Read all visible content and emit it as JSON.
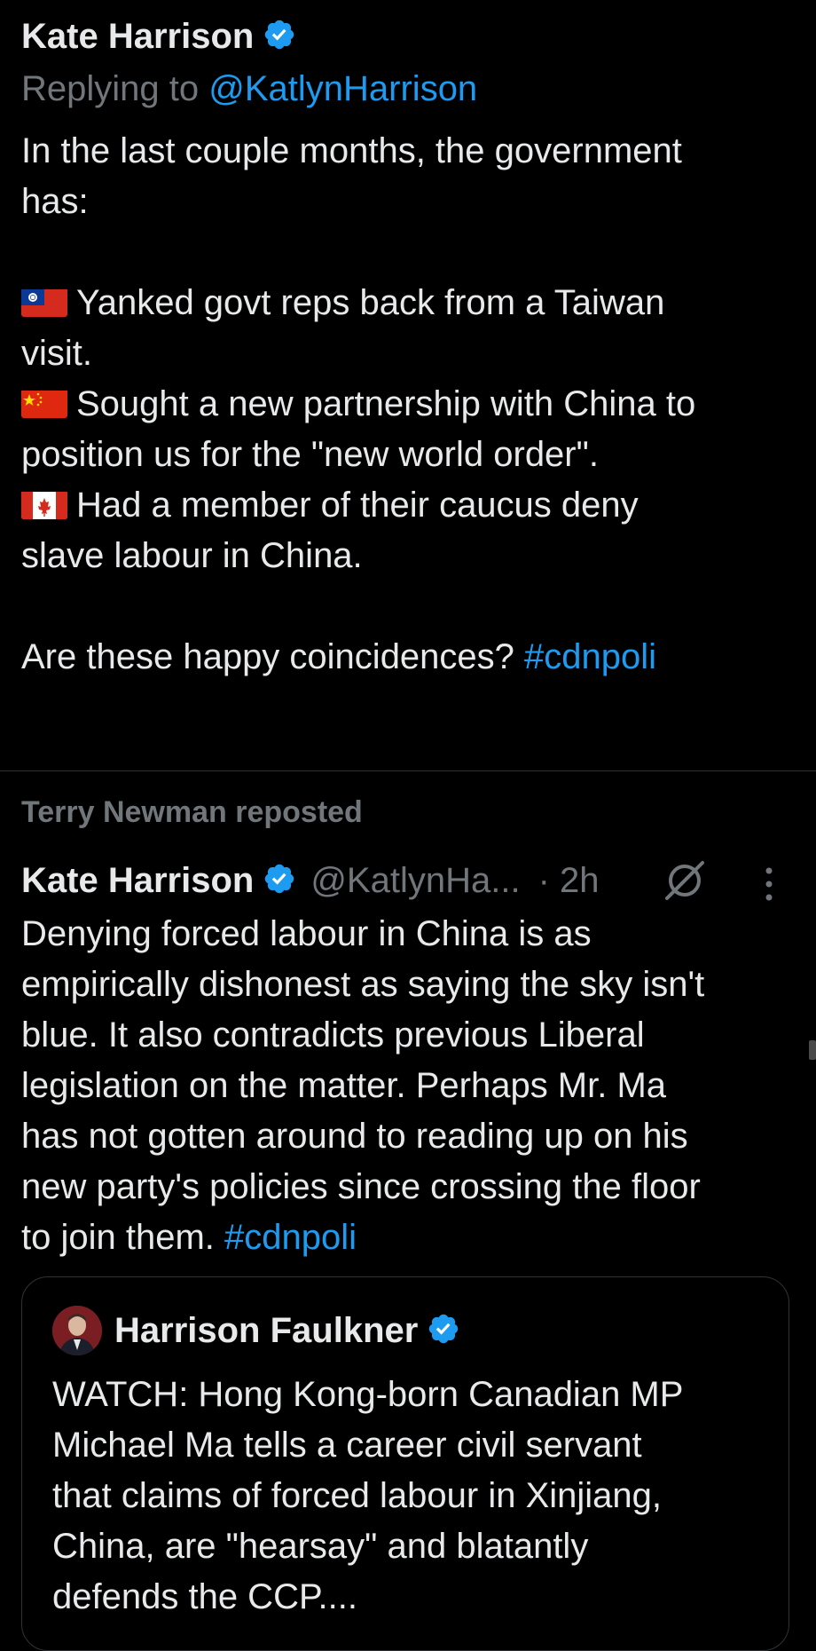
{
  "tweet1": {
    "author_name": "Kate Harrison",
    "replying_prefix": "Replying to",
    "replying_handle": "@KatlynHarrison",
    "lines": [
      "In the last couple months, the government",
      "has:",
      "",
      "Yanked govt reps back from a Taiwan",
      "visit.",
      "Sought a new partnership with China to",
      "position us for the \"new world order\".",
      "Had a member of their caucus deny",
      "slave labour in China.",
      "",
      "Are these happy coincidences?"
    ],
    "hashtag": "#cdnpoli",
    "flags": [
      "taiwan-flag-icon",
      "china-flag-icon",
      "canada-flag-icon"
    ]
  },
  "tweet2": {
    "repost_label": "Terry Newman reposted",
    "author_name": "Kate Harrison",
    "handle": "@KatlynHa...",
    "time": "· 2h",
    "lines": [
      "Denying forced labour in China is as",
      "empirically dishonest as saying the sky isn't",
      "blue. It also contradicts previous Liberal",
      "legislation on the matter. Perhaps Mr. Ma",
      "has not gotten around to reading up on his",
      "new party's policies since crossing the floor",
      "to join them."
    ],
    "hashtag": "#cdnpoli"
  },
  "quote": {
    "author_name": "Harrison Faulkner",
    "lines": [
      "WATCH: Hong Kong-born Canadian MP",
      "Michael Ma tells a career civil servant",
      "that claims of forced labour in Xinjiang,",
      "China, are \"hearsay\" and blatantly",
      "defends the CCP...."
    ]
  },
  "colors": {
    "background": "#000000",
    "text": "#e7e9ea",
    "muted": "#71767b",
    "link": "#1d9bf0",
    "verified": "#1d9bf0"
  }
}
